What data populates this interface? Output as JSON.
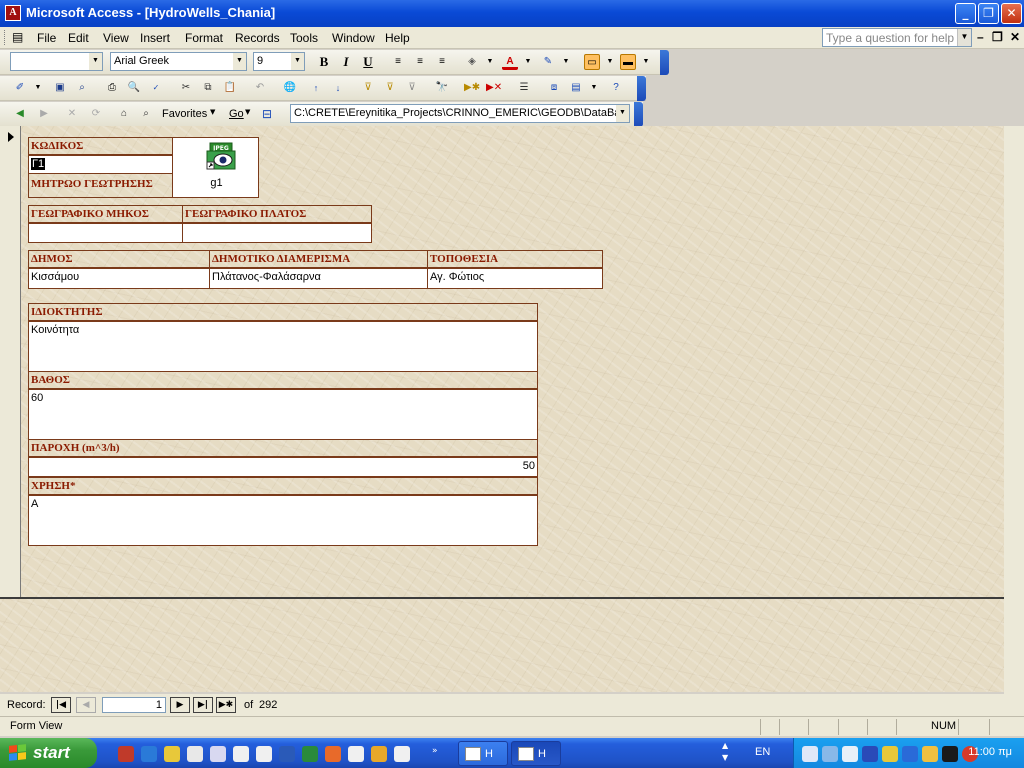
{
  "window": {
    "title": "Microsoft Access - [HydroWells_Chania]"
  },
  "menu": {
    "items": [
      "File",
      "Edit",
      "View",
      "Insert",
      "Format",
      "Records",
      "Tools",
      "Window",
      "Help"
    ],
    "help_placeholder": "Type a question for help"
  },
  "toolbar_format": {
    "font_name": "Arial Greek",
    "font_size": "9",
    "object_combo": "",
    "bold": "B",
    "italic": "I",
    "underline": "U"
  },
  "toolbar_web": {
    "favorites": "Favorites",
    "go": "Go",
    "address": "C:\\CRETE\\Ereynitika_Projects\\CRINNO_EMERIC\\GEODB\\DataBase"
  },
  "form": {
    "code_label": "ΚΩΔΙΚΟΣ",
    "code_value": "Γ1",
    "registry_label": "ΜΗΤΡΩΟ ΓΕΩΤΡΗΣΗΣ",
    "registry_value": "",
    "image_caption": "g1",
    "image_badge": "JPEG",
    "longitude_label": "ΓΕΩΓΡΑΦΙΚΟ ΜΗΚΟΣ",
    "longitude_value": "",
    "latitude_label": "ΓΕΩΓΡΑΦΙΚΟ ΠΛΑΤΟΣ",
    "latitude_value": "",
    "municipality_label": "ΔΗΜΟΣ",
    "municipality_value": "Κισσάμου",
    "district_label": "ΔΗΜΟΤΙΚΟ ΔΙΑΜΕΡΙΣΜΑ",
    "district_value": "Πλάτανος-Φαλάσαρνα",
    "location_label": "ΤΟΠΟΘΕΣΙΑ",
    "location_value": "Αγ. Φώτιος",
    "owner_label": "ΙΔΙΟΚΤΗΤΗΣ",
    "owner_value": "Κοινότητα",
    "depth_label": "ΒΑΘΟΣ",
    "depth_value": "60",
    "flow_label": "ΠΑΡΟΧΗ (m^3/h)",
    "flow_value": "50",
    "use_label": "ΧΡΗΣΗ*",
    "use_value": "Α"
  },
  "record_nav": {
    "label": "Record:",
    "current": "1",
    "of_label": "of",
    "total": "292"
  },
  "status": {
    "view": "Form View",
    "num": "NUM"
  },
  "taskbar": {
    "start": "start",
    "tasks": [
      "H",
      "H"
    ],
    "lang": "EN",
    "clock": "11:00 πμ"
  }
}
